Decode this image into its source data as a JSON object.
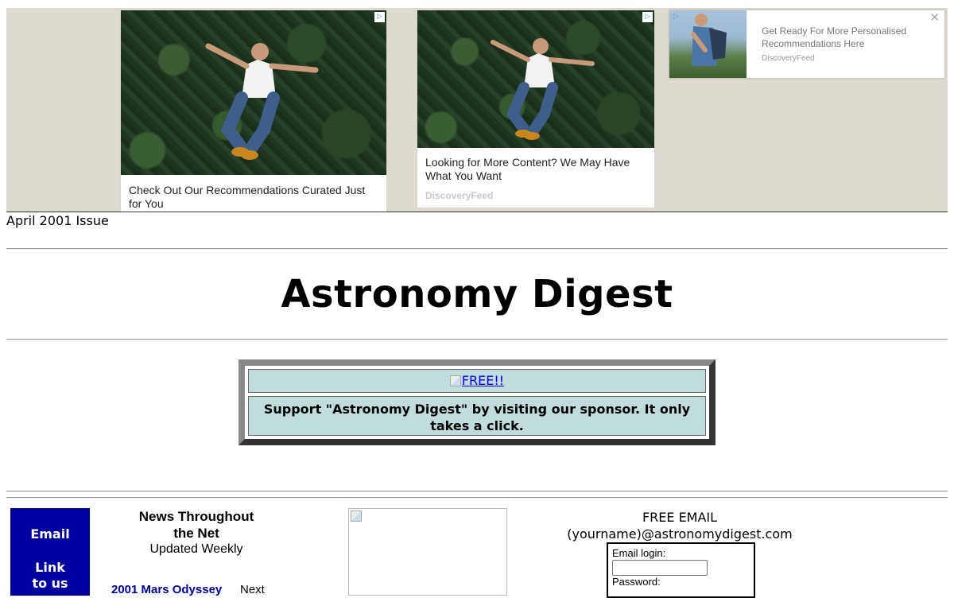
{
  "ads": {
    "card1": {
      "title": "Check Out Our Recommendations Curated Just for You"
    },
    "card2": {
      "title": "Looking for More Content? We May Have What You Want",
      "source": "DiscoveryFeed"
    },
    "card3": {
      "title": "Get Ready For More Personalised Recommendations Here",
      "source": "DiscoveryFeed",
      "close": "✕"
    },
    "ad_choice_glyph": "▷"
  },
  "page": {
    "issue": "April 2001 Issue",
    "title": "Astronomy Digest"
  },
  "sponsor": {
    "link_text": "FREE!!",
    "message": "Support \"Astronomy Digest\" by visiting our sponsor. It only takes a click."
  },
  "email_box": {
    "line1": "Email",
    "line2": "Link to us"
  },
  "news": {
    "heading": "News Throughout the Net",
    "sub": "Updated Weekly",
    "link": "2001 Mars Odyssey",
    "link_suffix": "Next"
  },
  "free_email": {
    "line1": "FREE EMAIL",
    "line2": "(yourname)@astronomydigest.com",
    "login_label": "Email login:",
    "password_label": "Password:"
  },
  "colors": {
    "ad_bg": "#dedad0",
    "sponsor_cell": "#c1dcdc",
    "email_box": "#0000a0",
    "link": "#0000ee"
  }
}
